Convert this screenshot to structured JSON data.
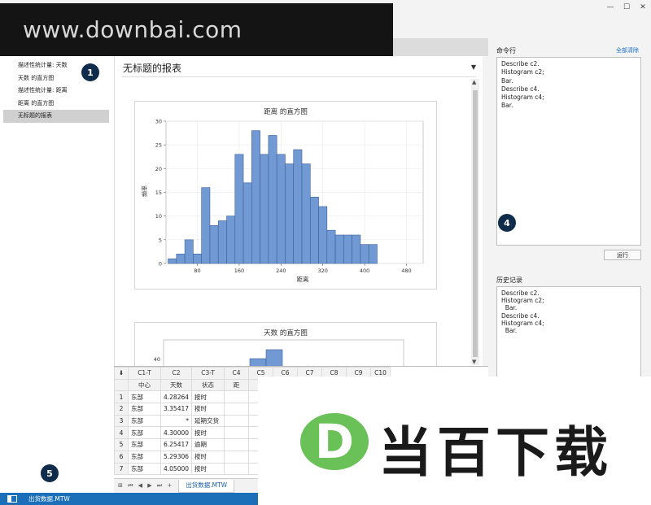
{
  "watermark": "www.downbai.com",
  "window_controls": [
    "—",
    "☐",
    "✕"
  ],
  "navigator": {
    "items": [
      "描述性统计量: 天数",
      "天数 的直方图",
      "描述性统计量: 距离",
      "距离 的直方图",
      "无标题的报表"
    ],
    "selected_index": 4
  },
  "badges": [
    "1",
    "4",
    "5"
  ],
  "report": {
    "title": "无标题的报表",
    "dropdown_glyph": "▼"
  },
  "chart_data": [
    {
      "type": "bar",
      "title": "距离 的直方图",
      "xlabel": "距离",
      "ylabel": "频率",
      "x_ticks": [
        80,
        160,
        240,
        320,
        400,
        480
      ],
      "y_ticks": [
        0,
        5,
        10,
        15,
        20,
        25,
        30
      ],
      "ylim": [
        0,
        30
      ],
      "xlim": [
        20,
        512
      ],
      "bin_width": 16,
      "bin_start": 24,
      "values": [
        1,
        2,
        5,
        2,
        16,
        8,
        9,
        10,
        23,
        17,
        28,
        23,
        27,
        23,
        21,
        24,
        21,
        14,
        12,
        7,
        6,
        6,
        6,
        4,
        4
      ],
      "bar_color": "#7199d4",
      "grid": true
    },
    {
      "type": "bar",
      "title": "天数 的直方图",
      "y_ticks_visible": [
        40
      ],
      "bar_color": "#7199d4"
    }
  ],
  "worksheet": {
    "col_ids": [
      "C1-T",
      "C2",
      "C3-T",
      "C4",
      "C5",
      "C6",
      "C7",
      "C8",
      "C9",
      "C10"
    ],
    "col_names": [
      "中心",
      "天数",
      "状态",
      "距",
      "",
      "",
      "",
      "",
      "",
      ""
    ],
    "rows": [
      [
        "1",
        "东部",
        "4.28264",
        "按时"
      ],
      [
        "2",
        "东部",
        "3.35417",
        "按时"
      ],
      [
        "3",
        "东部",
        "*",
        "延期交货"
      ],
      [
        "4",
        "东部",
        "4.30000",
        "按时"
      ],
      [
        "5",
        "东部",
        "6.25417",
        "逾期"
      ],
      [
        "6",
        "东部",
        "5.29306",
        "按时"
      ],
      [
        "7",
        "东部",
        "4.05000",
        "按时"
      ]
    ],
    "tab_label": "出货数据.MTW",
    "tab_nav": "⊞ ⏮ ◀ ▶ ⏭ +",
    "corner_glyph": "⬇"
  },
  "command_line": {
    "label": "命令行",
    "clear_label": "全部清除",
    "text": "Describe c2.\nHistogram c2;\nBar.\nDescribe c4.\nHistogram c4;\nBar.",
    "run_label": "运行"
  },
  "history": {
    "label": "历史记录",
    "lines": [
      "Describe c2.",
      "Histogram c2;",
      "  Bar.",
      "Describe c4.",
      "Histogram c4;",
      "  Bar."
    ]
  },
  "status_bar": {
    "file": "出货数据.MTW"
  },
  "logo": {
    "letter": "D",
    "text": "当百下载"
  }
}
